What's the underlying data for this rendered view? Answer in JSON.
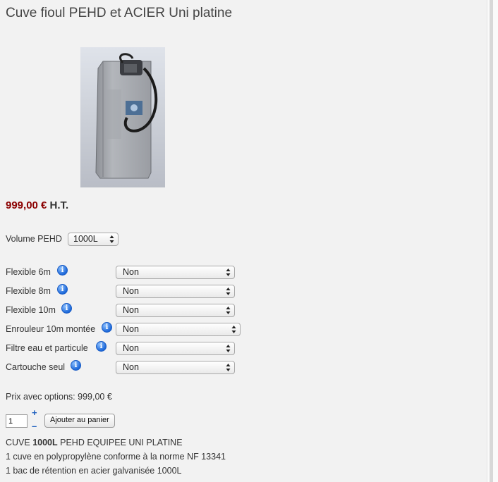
{
  "product": {
    "title": "Cuve fioul PEHD et ACIER Uni platine",
    "image_alt": "Cuve fioul PEHD et ACIER Uni platine",
    "price_amount": "999,00 €",
    "price_suffix": " H.T."
  },
  "volume": {
    "label": "Volume PEHD",
    "selected": "1000L"
  },
  "options": [
    {
      "label": "Flexible 6m",
      "selected": "Non"
    },
    {
      "label": "Flexible 8m",
      "selected": "Non"
    },
    {
      "label": "Flexible 10m",
      "selected": "Non"
    },
    {
      "label": "Enrouleur 10m montée",
      "selected": "Non"
    },
    {
      "label": "Filtre eau et particule",
      "selected": "Non"
    },
    {
      "label": "Cartouche seul",
      "selected": "Non"
    }
  ],
  "price_with_options": "Prix avec options: 999,00 €",
  "cart": {
    "quantity": "1",
    "plus": "+",
    "minus": "–",
    "add_label": "Ajouter au panier"
  },
  "description": {
    "line1_prefix": "CUVE ",
    "line1_bold": "1000L",
    "line1_suffix": " PEHD EQUIPEE UNI PLATINE",
    "line2": "1 cuve en polypropylène conforme à la norme NF 13341",
    "line3": "1 bac de rétention en acier galvanisée 1000L"
  },
  "icons": {
    "info": "info-icon",
    "select_arrows": "updown-arrows-icon"
  },
  "colors": {
    "price": "#8b0000",
    "info_icon": "#1d68d9"
  }
}
